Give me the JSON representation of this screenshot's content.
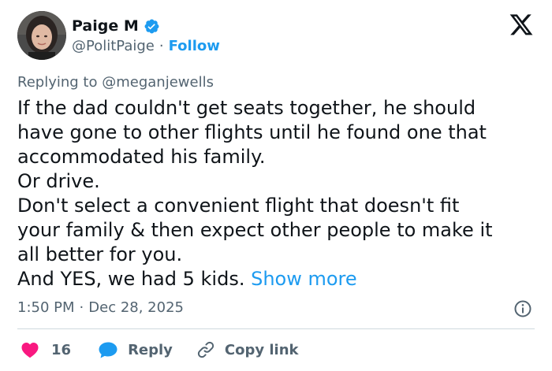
{
  "author": {
    "display_name": "Paige M",
    "handle": "@PolitPaige",
    "separator": "·",
    "follow_label": "Follow",
    "verified": true,
    "avatar_icon": "profile-photo"
  },
  "logo": {
    "icon": "x-logo"
  },
  "reply_context": {
    "prefix": "Replying to",
    "mention": "@meganjewells"
  },
  "body": {
    "lines": [
      "If the dad couldn't get seats together, he should",
      "have gone to other flights until he found one that",
      "accommodated his family.",
      "Or drive.",
      "Don't select a convenient flight that doesn't fit",
      "your family & then expect other people to make it",
      "all better for you.",
      "And YES, we had 5 kids."
    ],
    "show_more_label": "Show more"
  },
  "meta": {
    "time": "1:50 PM",
    "separator": "·",
    "date": "Dec 28, 2025",
    "info_icon": "info-icon"
  },
  "actions": {
    "like_count": "16",
    "reply_label": "Reply",
    "copy_link_label": "Copy link"
  },
  "colors": {
    "accent": "#1d9bf0",
    "like": "#f91880",
    "text": "#0f1419",
    "secondary": "#536471",
    "divider": "#cfd9de"
  }
}
